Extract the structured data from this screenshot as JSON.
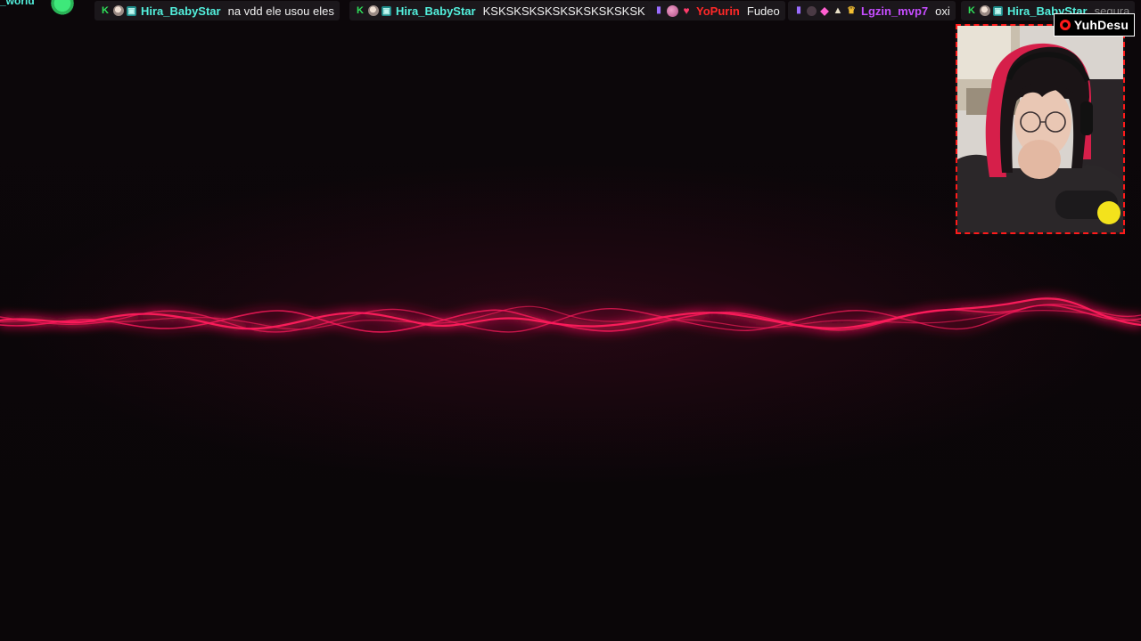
{
  "chat": {
    "partial": {
      "name": "_world"
    },
    "messages": [
      {
        "user": "Hira_BabyStar",
        "text": "na vdd ele usou eles"
      },
      {
        "user": "Hira_BabyStar",
        "text": "KSKSKSKSKSKSKSKSKSKSK"
      },
      {
        "user": "YoPurin",
        "text": "Fudeo"
      },
      {
        "user": "Lgzin_mvp7",
        "text": "oxi"
      },
      {
        "user": "Hira_BabyStar",
        "text": "segura"
      }
    ]
  },
  "overlay": {
    "handle": "YuhDesu",
    "handle_icon": "camera-icon"
  },
  "colors": {
    "background": "#0b0609",
    "waveform": "#ff1a5c",
    "frame": "#ff1a1a",
    "teal_user": "#53f0dd",
    "red_user": "#ff2828",
    "purple_user": "#c64dff"
  }
}
